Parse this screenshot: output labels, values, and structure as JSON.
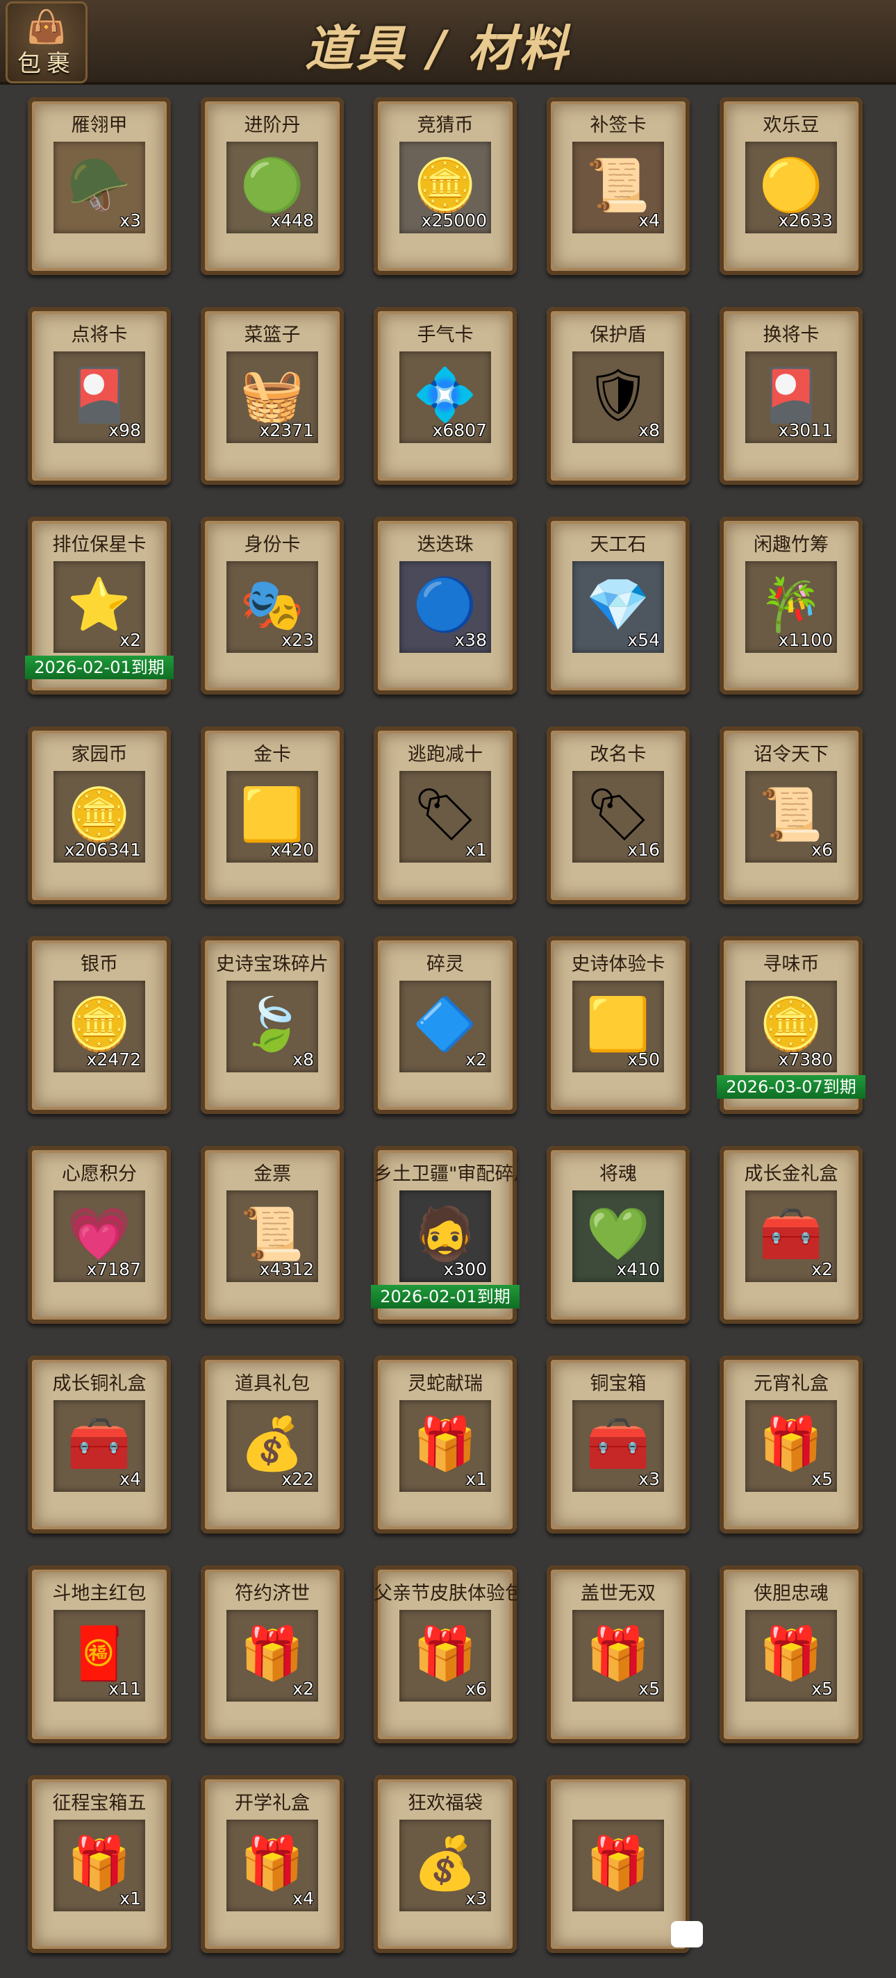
{
  "header": {
    "bag_label": "包裹",
    "title": "道具 / 材料"
  },
  "items": [
    {
      "name": "雁翎甲",
      "count": "x3",
      "icon": "🪖",
      "bg": "#7a6245"
    },
    {
      "name": "进阶丹",
      "count": "x448",
      "icon": "🟢",
      "bg": "#6e6048"
    },
    {
      "name": "竞猜币",
      "count": "x25000",
      "icon": "🪙",
      "bg": "#6b6358"
    },
    {
      "name": "补签卡",
      "count": "x4",
      "icon": "📜",
      "bg": "#6e5640"
    },
    {
      "name": "欢乐豆",
      "count": "x2633",
      "icon": "🟡",
      "bg": "#6b5a44"
    },
    {
      "name": "点将卡",
      "count": "x98",
      "icon": "🎴",
      "bg": "#6b5a44"
    },
    {
      "name": "菜篮子",
      "count": "x2371",
      "icon": "🧺",
      "bg": "#6b5a44"
    },
    {
      "name": "手气卡",
      "count": "x6807",
      "icon": "💠",
      "bg": "#6b5a44"
    },
    {
      "name": "保护盾",
      "count": "x8",
      "icon": "🛡",
      "bg": "#6b5a44"
    },
    {
      "name": "换将卡",
      "count": "x3011",
      "icon": "🎴",
      "bg": "#6b5a44"
    },
    {
      "name": "排位保星卡",
      "count": "x2",
      "icon": "⭐",
      "bg": "#6b5a44",
      "expiry": "2026-02-01到期"
    },
    {
      "name": "身份卡",
      "count": "x23",
      "icon": "🎭",
      "bg": "#6b5a44"
    },
    {
      "name": "迭迭珠",
      "count": "x38",
      "icon": "🔵",
      "bg": "#4a4a5a"
    },
    {
      "name": "天工石",
      "count": "x54",
      "icon": "💎",
      "bg": "#4e5660"
    },
    {
      "name": "闲趣竹筹",
      "count": "x1100",
      "icon": "🎋",
      "bg": "#6b5a44"
    },
    {
      "name": "家园币",
      "count": "x206341",
      "icon": "🪙",
      "bg": "#6b5a44"
    },
    {
      "name": "金卡",
      "count": "x420",
      "icon": "🟨",
      "bg": "#6b5a44"
    },
    {
      "name": "逃跑减十",
      "count": "x1",
      "icon": "🏷",
      "bg": "#6b5a44"
    },
    {
      "name": "改名卡",
      "count": "x16",
      "icon": "🏷",
      "bg": "#6b5a44"
    },
    {
      "name": "诏令天下",
      "count": "x6",
      "icon": "📜",
      "bg": "#6b5a44"
    },
    {
      "name": "银币",
      "count": "x2472",
      "icon": "🪙",
      "bg": "#6b5a44"
    },
    {
      "name": "史诗宝珠碎片",
      "count": "x8",
      "icon": "🍃",
      "bg": "#6b5a44"
    },
    {
      "name": "碎灵",
      "count": "x2",
      "icon": "🔷",
      "bg": "#6b5a44"
    },
    {
      "name": "史诗体验卡",
      "count": "x50",
      "icon": "🟨",
      "bg": "#6b5a44"
    },
    {
      "name": "寻味币",
      "count": "x7380",
      "icon": "🪙",
      "bg": "#6b5a44",
      "expiry": "2026-03-07到期"
    },
    {
      "name": "心愿积分",
      "count": "x7187",
      "icon": "💗",
      "bg": "#6b5a44"
    },
    {
      "name": "金票",
      "count": "x4312",
      "icon": "📜",
      "bg": "#6b5a44"
    },
    {
      "name": "乡土卫疆\"审配碎片",
      "count": "x300",
      "icon": "🧔",
      "bg": "#3a3a3a",
      "expiry": "2026-02-01到期"
    },
    {
      "name": "将魂",
      "count": "x410",
      "icon": "💚",
      "bg": "#3e4a3a"
    },
    {
      "name": "成长金礼盒",
      "count": "x2",
      "icon": "🧰",
      "bg": "#6b5a44"
    },
    {
      "name": "成长铜礼盒",
      "count": "x4",
      "icon": "🧰",
      "bg": "#6b5a44"
    },
    {
      "name": "道具礼包",
      "count": "x22",
      "icon": "💰",
      "bg": "#6b5a44"
    },
    {
      "name": "灵蛇献瑞",
      "count": "x1",
      "icon": "🎁",
      "bg": "#6b5a44"
    },
    {
      "name": "铜宝箱",
      "count": "x3",
      "icon": "🧰",
      "bg": "#6b5a44"
    },
    {
      "name": "元宵礼盒",
      "count": "x5",
      "icon": "🎁",
      "bg": "#6b5a44"
    },
    {
      "name": "斗地主红包",
      "count": "x11",
      "icon": "🧧",
      "bg": "#6b5a44"
    },
    {
      "name": "符约济世",
      "count": "x2",
      "icon": "🎁",
      "bg": "#6b5a44"
    },
    {
      "name": "父亲节皮肤体验包",
      "count": "x6",
      "icon": "🎁",
      "bg": "#6b5a44"
    },
    {
      "name": "盖世无双",
      "count": "x5",
      "icon": "🎁",
      "bg": "#6b5a44"
    },
    {
      "name": "侠胆忠魂",
      "count": "x5",
      "icon": "🎁",
      "bg": "#6b5a44"
    },
    {
      "name": "征程宝箱五",
      "count": "x1",
      "icon": "🎁",
      "bg": "#6b5a44"
    },
    {
      "name": "开学礼盒",
      "count": "x4",
      "icon": "🎁",
      "bg": "#6b5a44"
    },
    {
      "name": "狂欢福袋",
      "count": "x3",
      "icon": "💰",
      "bg": "#6b5a44"
    },
    {
      "name": "",
      "count": "",
      "icon": "🎁",
      "bg": "#6b5a44"
    }
  ]
}
